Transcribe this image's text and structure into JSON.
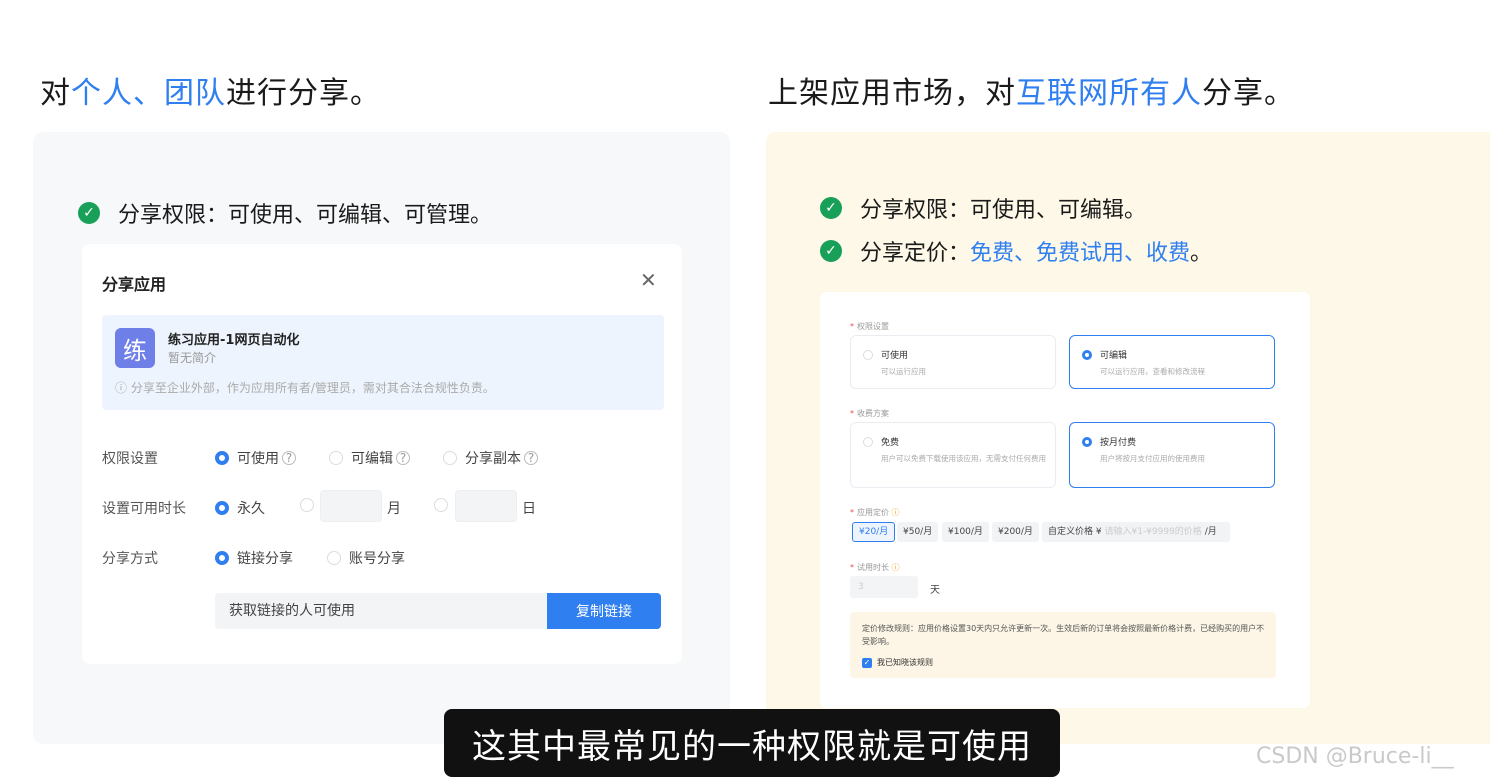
{
  "left_heading": {
    "pre": "对",
    "highlight": "个人、团队",
    "post": "进行分享。"
  },
  "right_heading": {
    "pre": "上架应用市场，对",
    "highlight": "互联网所有人",
    "post": "分享。"
  },
  "left_bullet": "分享权限：可使用、可编辑、可管理。",
  "right_bullets": [
    {
      "pre": "分享权限：可使用、可编辑。",
      "highlight": "",
      "post": ""
    },
    {
      "pre": "分享定价：",
      "highlight": "免费、免费试用、收费",
      "post": "。"
    }
  ],
  "share_dialog": {
    "title": "分享应用",
    "close_icon": "close-icon",
    "app": {
      "icon_char": "练",
      "name": "练习应用-1网页自动化",
      "desc": "暂无简介",
      "note": "ⓘ 分享至企业外部，作为应用所有者/管理员，需对其合法合规性负责。"
    },
    "permission": {
      "label": "权限设置",
      "options": [
        "可使用",
        "可编辑",
        "分享副本"
      ],
      "selected": "可使用"
    },
    "duration": {
      "label": "设置可用时长",
      "forever": "永久",
      "month_unit": "月",
      "day_unit": "日"
    },
    "method": {
      "label": "分享方式",
      "options": [
        "链接分享",
        "账号分享"
      ],
      "selected": "链接分享"
    },
    "link_text": "获取链接的人可使用",
    "copy_button": "复制链接"
  },
  "market_form": {
    "permission_label": "权限设置",
    "permission_options": [
      {
        "title": "可使用",
        "desc": "可以运行应用",
        "selected": false
      },
      {
        "title": "可编辑",
        "desc": "可以运行应用，查看和修改流程",
        "selected": true
      }
    ],
    "fee_label": "收费方案",
    "fee_options": [
      {
        "title": "免费",
        "desc": "用户可以免费下载使用该应用，无需支付任何费用",
        "selected": false
      },
      {
        "title": "按月付费",
        "desc": "用户将按月支付应用的使用费用",
        "selected": true
      }
    ],
    "price_label": "应用定价",
    "price_options": [
      "¥20/月",
      "¥50/月",
      "¥100/月",
      "¥200/月"
    ],
    "price_selected": "¥20/月",
    "custom_price": "自定义价格 ¥",
    "custom_price_placeholder": "请输入¥1-¥9999的价格",
    "custom_price_unit": "/月",
    "trial_label": "试用时长",
    "trial_value": "3",
    "trial_unit": "天",
    "rule_text": "定价修改规则：应用价格设置30天内只允许更新一次。生效后新的订单将会按照最新价格计费，已经购买的用户不受影响。",
    "rule_check": "我已知晓该规则"
  },
  "subtitle": "这其中最常见的一种权限就是可使用",
  "watermark": "CSDN @Bruce-li__",
  "colors": {
    "accent": "#2f7ff0",
    "check_green": "#18a058",
    "market_bg": "#fdf8e8"
  }
}
